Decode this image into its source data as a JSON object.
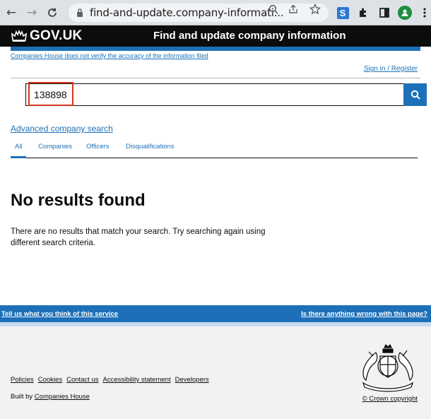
{
  "browser": {
    "url": "find-and-update.company-informati...",
    "back_icon": "←",
    "forward_icon": "→",
    "reload_icon": "C",
    "zoom_icon": "search-icon",
    "share_icon": "share-icon",
    "bookmark_icon": "star-icon"
  },
  "header": {
    "logo_text": "GOV.UK",
    "service_name": "Find and update company information"
  },
  "disclaimer": "Companies House does not verify the accuracy of the information filed",
  "signin": "Sign in / Register",
  "search": {
    "value": "138898"
  },
  "advanced_search": "Advanced company search",
  "tabs": [
    {
      "label": "All"
    },
    {
      "label": "Companies"
    },
    {
      "label": "Officers"
    },
    {
      "label": "Disqualifications"
    }
  ],
  "results": {
    "heading": "No results found",
    "message": "There are no results that match your search. Try searching again using different search criteria."
  },
  "feedback": {
    "left": "Tell us what you think of this service",
    "right": "Is there anything wrong with this page?"
  },
  "footer": {
    "links": [
      "Policies",
      "Cookies",
      "Contact us",
      "Accessibility statement",
      "Developers"
    ],
    "built_by_prefix": "Built by ",
    "built_by_link": "Companies House",
    "copyright": "© Crown copyright"
  },
  "colors": {
    "gov_blue": "#1d70b8",
    "gov_black": "#0b0c0c",
    "highlight_red": "#d4351c"
  }
}
